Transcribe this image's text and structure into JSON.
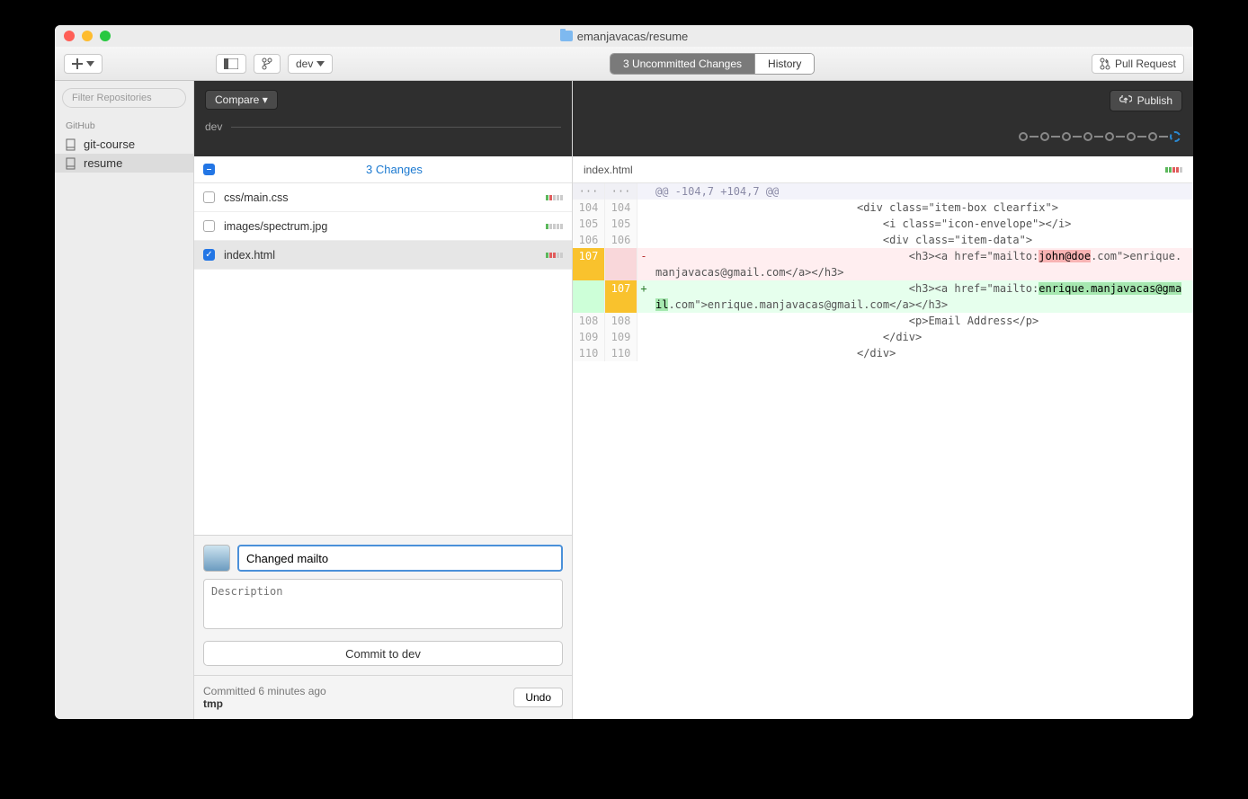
{
  "title_path": "emanjavacas/resume",
  "toolbar": {
    "branch": "dev",
    "tab_changes": "3 Uncommitted Changes",
    "tab_history": "History",
    "pull_request": "Pull Request"
  },
  "sidebar": {
    "filter_placeholder": "Filter Repositories",
    "group": "GitHub",
    "items": [
      {
        "label": "git-course"
      },
      {
        "label": "resume"
      }
    ]
  },
  "compare_label": "Compare",
  "branch_label": "dev",
  "changes_header": "3 Changes",
  "files": [
    {
      "label": "css/main.css",
      "checked": false
    },
    {
      "label": "images/spectrum.jpg",
      "checked": false
    },
    {
      "label": "index.html",
      "checked": true
    }
  ],
  "commit": {
    "summary": "Changed mailto",
    "desc_placeholder": "Description",
    "button": "Commit to dev",
    "footer_status": "Committed 6 minutes ago",
    "footer_name": "tmp",
    "undo": "Undo"
  },
  "publish_label": "Publish",
  "diff": {
    "file": "index.html",
    "hunk": "@@ -104,7 +104,7 @@",
    "lines": [
      {
        "a": "104",
        "b": "104",
        "t": "ctx",
        "c": "                               <div class=\"item-box clearfix\">"
      },
      {
        "a": "105",
        "b": "105",
        "t": "ctx",
        "c": "                                   <i class=\"icon-envelope\"></i>"
      },
      {
        "a": "106",
        "b": "106",
        "t": "ctx",
        "c": "                                   <div class=\"item-data\">"
      },
      {
        "a": "107",
        "b": "",
        "t": "del",
        "c": "                                       <h3><a href=\"mailto:",
        "hl": "john@doe",
        "c2": ".com\">enrique.manjavacas@gmail.com</a></h3>"
      },
      {
        "a": "",
        "b": "107",
        "t": "add",
        "c": "                                       <h3><a href=\"mailto:",
        "hl": "enrique.manjavacas@gmail",
        "c2": ".com\">enrique.manjavacas@gmail.com</a></h3>"
      },
      {
        "a": "108",
        "b": "108",
        "t": "ctx",
        "c": "                                       <p>Email Address</p>"
      },
      {
        "a": "109",
        "b": "109",
        "t": "ctx",
        "c": "                                   </div>"
      },
      {
        "a": "110",
        "b": "110",
        "t": "ctx",
        "c": "                               </div>"
      }
    ]
  }
}
